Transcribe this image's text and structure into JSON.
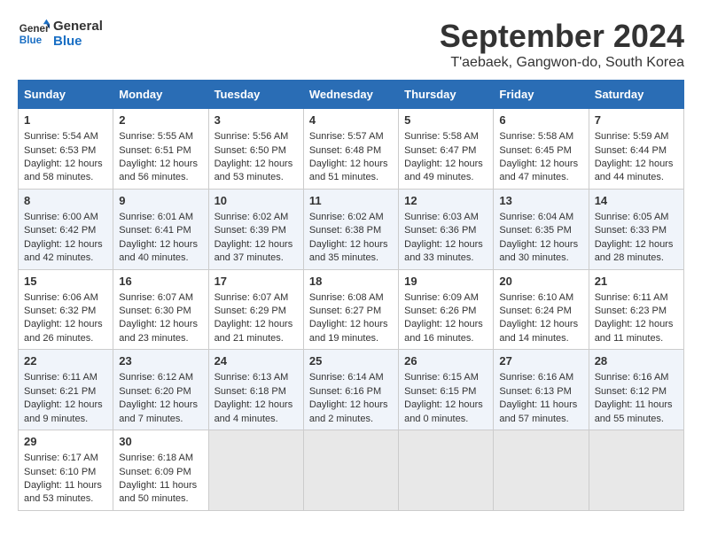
{
  "header": {
    "logo_line1": "General",
    "logo_line2": "Blue",
    "month_title": "September 2024",
    "location": "T'aebaek, Gangwon-do, South Korea"
  },
  "columns": [
    "Sunday",
    "Monday",
    "Tuesday",
    "Wednesday",
    "Thursday",
    "Friday",
    "Saturday"
  ],
  "weeks": [
    [
      {
        "day": "1",
        "rise": "Sunrise: 5:54 AM",
        "set": "Sunset: 6:53 PM",
        "daylight": "Daylight: 12 hours and 58 minutes."
      },
      {
        "day": "2",
        "rise": "Sunrise: 5:55 AM",
        "set": "Sunset: 6:51 PM",
        "daylight": "Daylight: 12 hours and 56 minutes."
      },
      {
        "day": "3",
        "rise": "Sunrise: 5:56 AM",
        "set": "Sunset: 6:50 PM",
        "daylight": "Daylight: 12 hours and 53 minutes."
      },
      {
        "day": "4",
        "rise": "Sunrise: 5:57 AM",
        "set": "Sunset: 6:48 PM",
        "daylight": "Daylight: 12 hours and 51 minutes."
      },
      {
        "day": "5",
        "rise": "Sunrise: 5:58 AM",
        "set": "Sunset: 6:47 PM",
        "daylight": "Daylight: 12 hours and 49 minutes."
      },
      {
        "day": "6",
        "rise": "Sunrise: 5:58 AM",
        "set": "Sunset: 6:45 PM",
        "daylight": "Daylight: 12 hours and 47 minutes."
      },
      {
        "day": "7",
        "rise": "Sunrise: 5:59 AM",
        "set": "Sunset: 6:44 PM",
        "daylight": "Daylight: 12 hours and 44 minutes."
      }
    ],
    [
      {
        "day": "8",
        "rise": "Sunrise: 6:00 AM",
        "set": "Sunset: 6:42 PM",
        "daylight": "Daylight: 12 hours and 42 minutes."
      },
      {
        "day": "9",
        "rise": "Sunrise: 6:01 AM",
        "set": "Sunset: 6:41 PM",
        "daylight": "Daylight: 12 hours and 40 minutes."
      },
      {
        "day": "10",
        "rise": "Sunrise: 6:02 AM",
        "set": "Sunset: 6:39 PM",
        "daylight": "Daylight: 12 hours and 37 minutes."
      },
      {
        "day": "11",
        "rise": "Sunrise: 6:02 AM",
        "set": "Sunset: 6:38 PM",
        "daylight": "Daylight: 12 hours and 35 minutes."
      },
      {
        "day": "12",
        "rise": "Sunrise: 6:03 AM",
        "set": "Sunset: 6:36 PM",
        "daylight": "Daylight: 12 hours and 33 minutes."
      },
      {
        "day": "13",
        "rise": "Sunrise: 6:04 AM",
        "set": "Sunset: 6:35 PM",
        "daylight": "Daylight: 12 hours and 30 minutes."
      },
      {
        "day": "14",
        "rise": "Sunrise: 6:05 AM",
        "set": "Sunset: 6:33 PM",
        "daylight": "Daylight: 12 hours and 28 minutes."
      }
    ],
    [
      {
        "day": "15",
        "rise": "Sunrise: 6:06 AM",
        "set": "Sunset: 6:32 PM",
        "daylight": "Daylight: 12 hours and 26 minutes."
      },
      {
        "day": "16",
        "rise": "Sunrise: 6:07 AM",
        "set": "Sunset: 6:30 PM",
        "daylight": "Daylight: 12 hours and 23 minutes."
      },
      {
        "day": "17",
        "rise": "Sunrise: 6:07 AM",
        "set": "Sunset: 6:29 PM",
        "daylight": "Daylight: 12 hours and 21 minutes."
      },
      {
        "day": "18",
        "rise": "Sunrise: 6:08 AM",
        "set": "Sunset: 6:27 PM",
        "daylight": "Daylight: 12 hours and 19 minutes."
      },
      {
        "day": "19",
        "rise": "Sunrise: 6:09 AM",
        "set": "Sunset: 6:26 PM",
        "daylight": "Daylight: 12 hours and 16 minutes."
      },
      {
        "day": "20",
        "rise": "Sunrise: 6:10 AM",
        "set": "Sunset: 6:24 PM",
        "daylight": "Daylight: 12 hours and 14 minutes."
      },
      {
        "day": "21",
        "rise": "Sunrise: 6:11 AM",
        "set": "Sunset: 6:23 PM",
        "daylight": "Daylight: 12 hours and 11 minutes."
      }
    ],
    [
      {
        "day": "22",
        "rise": "Sunrise: 6:11 AM",
        "set": "Sunset: 6:21 PM",
        "daylight": "Daylight: 12 hours and 9 minutes."
      },
      {
        "day": "23",
        "rise": "Sunrise: 6:12 AM",
        "set": "Sunset: 6:20 PM",
        "daylight": "Daylight: 12 hours and 7 minutes."
      },
      {
        "day": "24",
        "rise": "Sunrise: 6:13 AM",
        "set": "Sunset: 6:18 PM",
        "daylight": "Daylight: 12 hours and 4 minutes."
      },
      {
        "day": "25",
        "rise": "Sunrise: 6:14 AM",
        "set": "Sunset: 6:16 PM",
        "daylight": "Daylight: 12 hours and 2 minutes."
      },
      {
        "day": "26",
        "rise": "Sunrise: 6:15 AM",
        "set": "Sunset: 6:15 PM",
        "daylight": "Daylight: 12 hours and 0 minutes."
      },
      {
        "day": "27",
        "rise": "Sunrise: 6:16 AM",
        "set": "Sunset: 6:13 PM",
        "daylight": "Daylight: 11 hours and 57 minutes."
      },
      {
        "day": "28",
        "rise": "Sunrise: 6:16 AM",
        "set": "Sunset: 6:12 PM",
        "daylight": "Daylight: 11 hours and 55 minutes."
      }
    ],
    [
      {
        "day": "29",
        "rise": "Sunrise: 6:17 AM",
        "set": "Sunset: 6:10 PM",
        "daylight": "Daylight: 11 hours and 53 minutes."
      },
      {
        "day": "30",
        "rise": "Sunrise: 6:18 AM",
        "set": "Sunset: 6:09 PM",
        "daylight": "Daylight: 11 hours and 50 minutes."
      },
      null,
      null,
      null,
      null,
      null
    ]
  ]
}
